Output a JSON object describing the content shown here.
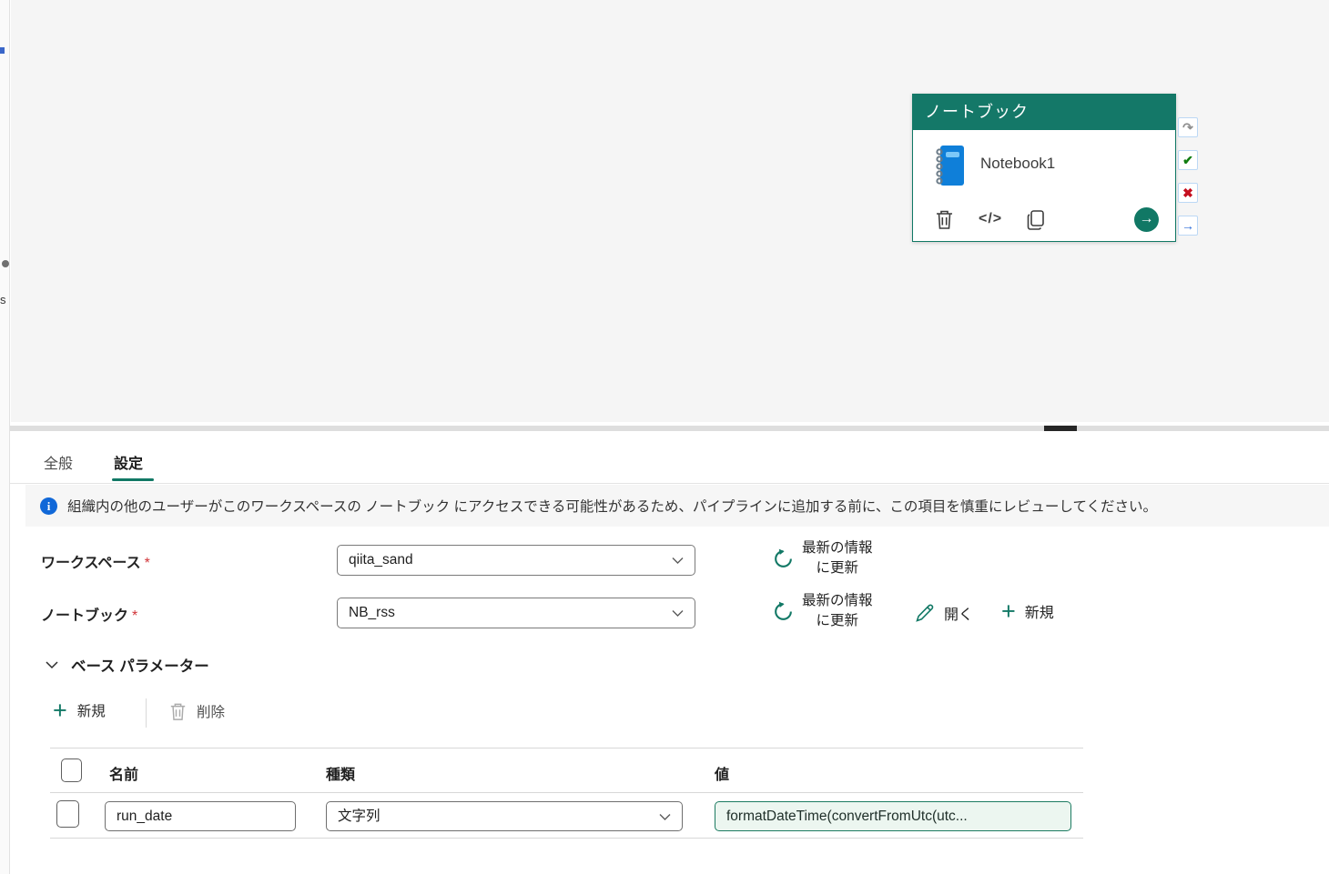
{
  "colors": {
    "accent_teal": "#117865",
    "card_header_bg": "#147868",
    "notebook_blue": "#0f7fd9",
    "info_blue": "#1168d8",
    "success_green": "#107c10",
    "fail_red": "#c50f1f",
    "completion_blue": "#2b6bd8",
    "value_field_bg": "#ecf6f0",
    "value_field_border": "#1c7b61"
  },
  "left_edge": {
    "fragment_text": "s"
  },
  "canvas": {
    "activity_card": {
      "header": "ノートブック",
      "name": "Notebook1",
      "code_icon_glyph": "</>",
      "go_arrow_glyph": "→"
    },
    "ports": {
      "skip_glyph": "↷",
      "succeeded_glyph": "✔",
      "failed_glyph": "✖",
      "completed_glyph": "→"
    }
  },
  "panel": {
    "tabs": {
      "general": "全般",
      "settings": "設定"
    },
    "banner": {
      "text": "組織内の他のユーザーがこのワークスペースの ノートブック にアクセスできる可能性があるため、パイプラインに追加する前に、この項目を慎重にレビューしてください。"
    },
    "workspace": {
      "label": "ワークスペース",
      "required_mark": "*",
      "value": "qiita_sand",
      "refresh_line1": "最新の情報",
      "refresh_line2": "に更新"
    },
    "notebook": {
      "label": "ノートブック",
      "required_mark": "*",
      "value": "NB_rss",
      "refresh_line1": "最新の情報",
      "refresh_line2": "に更新",
      "open_label": "開く",
      "new_label": "新規"
    },
    "base_params": {
      "title": "ベース パラメーター",
      "toolbar": {
        "new_label": "新規",
        "delete_label": "削除"
      },
      "table": {
        "headers": {
          "name": "名前",
          "type": "種類",
          "value": "値"
        },
        "rows": [
          {
            "name": "run_date",
            "type": "文字列",
            "value": "formatDateTime(convertFromUtc(utc..."
          }
        ]
      }
    }
  }
}
